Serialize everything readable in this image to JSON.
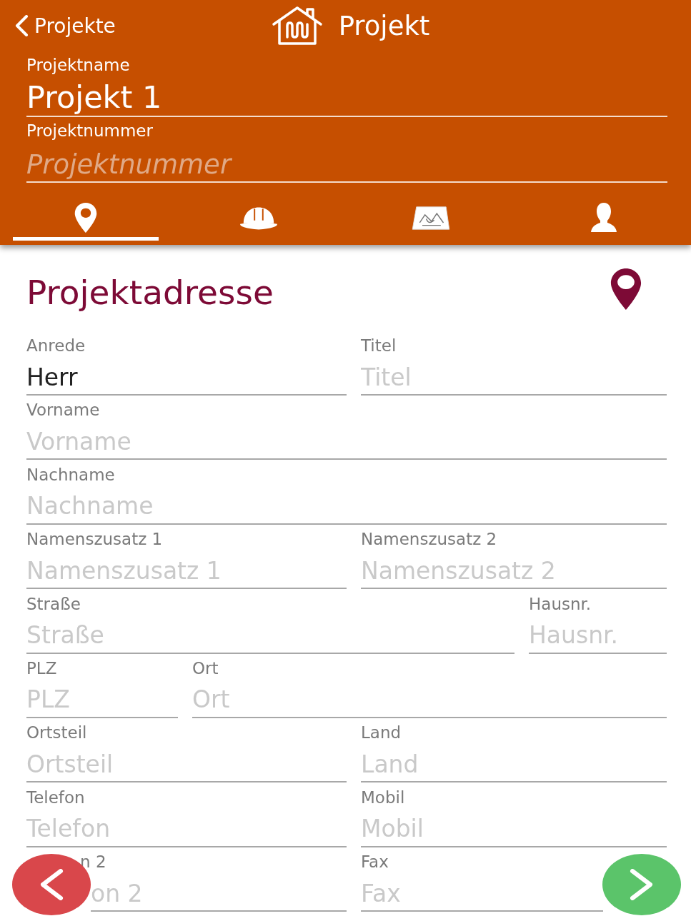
{
  "nav": {
    "back_label": "Projekte",
    "title": "Projekt"
  },
  "project_fields": [
    {
      "label": "Projektname",
      "value": "Projekt 1"
    },
    {
      "label": "Projektnummer",
      "placeholder": "Projektnummer"
    }
  ],
  "tabs": [
    {
      "selected": true
    },
    {
      "selected": false
    },
    {
      "selected": false
    },
    {
      "selected": false
    }
  ],
  "section": {
    "title": "Projektadresse"
  },
  "rows": [
    {
      "kind": "half",
      "fields": [
        {
          "label": "Anrede",
          "value": "Herr"
        },
        {
          "label": "Titel",
          "placeholder": "Titel"
        }
      ]
    },
    {
      "kind": "full",
      "fields": [
        {
          "label": "Vorname",
          "placeholder": "Vorname"
        }
      ]
    },
    {
      "kind": "full",
      "fields": [
        {
          "label": "Nachname",
          "placeholder": "Nachname"
        }
      ]
    },
    {
      "kind": "half",
      "fields": [
        {
          "label": "Namenszusatz 1",
          "placeholder": "Namenszusatz 1"
        },
        {
          "label": "Namenszusatz 2",
          "placeholder": "Namenszusatz 2"
        }
      ]
    },
    {
      "kind": "wide-narrow",
      "fields": [
        {
          "label": "Straße",
          "placeholder": "Straße"
        },
        {
          "label": "Hausnr.",
          "placeholder": "Hausnr."
        }
      ]
    },
    {
      "kind": "narrow-wide",
      "fields": [
        {
          "label": "PLZ",
          "placeholder": "PLZ"
        },
        {
          "label": "Ort",
          "placeholder": "Ort"
        }
      ]
    },
    {
      "kind": "half",
      "fields": [
        {
          "label": "Ortsteil",
          "placeholder": "Ortsteil"
        },
        {
          "label": "Land",
          "placeholder": "Land"
        }
      ]
    },
    {
      "kind": "half",
      "fields": [
        {
          "label": "Telefon",
          "placeholder": "Telefon"
        },
        {
          "label": "Mobil",
          "placeholder": "Mobil"
        }
      ]
    },
    {
      "kind": "half-under-buttons",
      "fields": [
        {
          "label": "n 2",
          "placeholder": "on 2"
        },
        {
          "label": "Fax",
          "placeholder": "Fax"
        }
      ]
    }
  ]
}
